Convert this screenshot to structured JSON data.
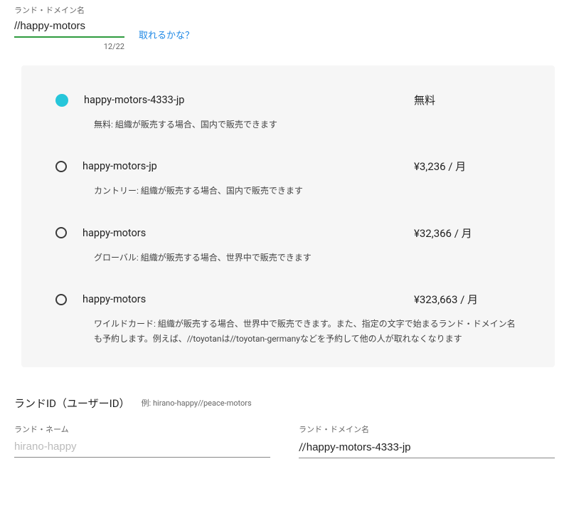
{
  "topInput": {
    "label": "ランド・ドメイン名",
    "prefix": "//",
    "value": "happy-motors",
    "counter": "12/22"
  },
  "checkLink": "取れるかな？",
  "options": [
    {
      "selected": true,
      "name": "happy-motors-4333-jp",
      "price": "無料",
      "desc": "無料: 組織が販売する場合、国内で販売できます"
    },
    {
      "selected": false,
      "name": "happy-motors-jp",
      "price": "¥3,236 / 月",
      "desc": "カントリー: 組織が販売する場合、国内で販売できます"
    },
    {
      "selected": false,
      "name": "happy-motors",
      "price": "¥32,366 / 月",
      "desc": "グローバル: 組織が販売する場合、世界中で販売できます"
    },
    {
      "selected": false,
      "name": "happy-motors",
      "price": "¥323,663 / 月",
      "desc": "ワイルドカード: 組織が販売する場合、世界中で販売できます。また、指定の文字で始まるランド・ドメイン名も予約します。例えば、//toyotanは//toyotan-germanyなどを予約して他の人が取れなくなります"
    }
  ],
  "bottom": {
    "sectionTitle": "ランドID（ユーザーID）",
    "example": "例: hirano-happy//peace-motors",
    "landName": {
      "label": "ランド・ネーム",
      "placeholder": "hirano-happy",
      "value": ""
    },
    "landDomain": {
      "label": "ランド・ドメイン名",
      "prefix": "//",
      "value": "happy-motors-4333-jp"
    }
  }
}
